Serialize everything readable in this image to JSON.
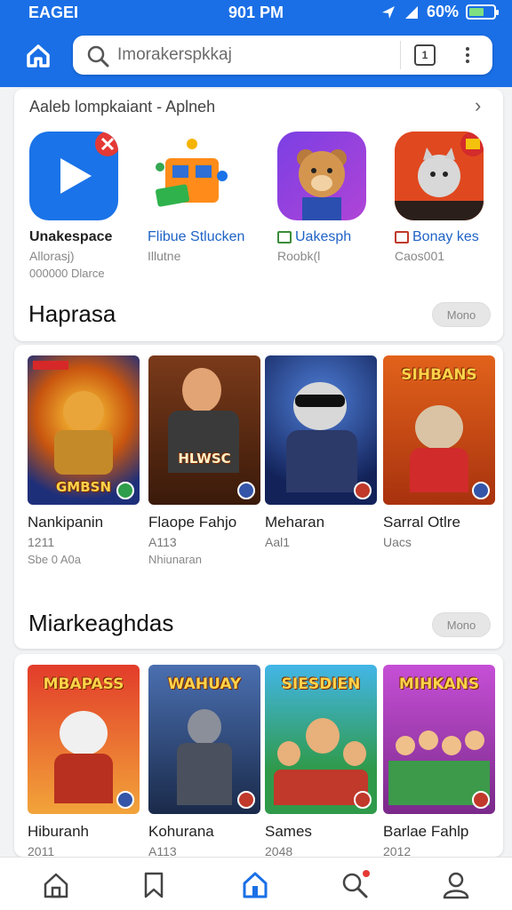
{
  "status_bar": {
    "carrier": "EAGEI",
    "time": "901 PM",
    "battery": "60%",
    "battery_level": 0.6
  },
  "app_bar": {
    "search_placeholder": "Imorakerspkkaj",
    "tabs_count": "1"
  },
  "featured": {
    "header": "Aaleb lompkaiant - Aplneh",
    "apps": [
      {
        "name": "Unakespace",
        "line1": "Allorasj)",
        "line2": "000000 Dlarce",
        "icon": "play-app-icon"
      },
      {
        "name": "Flibue Stlucken",
        "line1": "Illutne",
        "line2": "",
        "icon": "shop-app-icon"
      },
      {
        "name": "Uakesph",
        "line1": "Roobk(l",
        "line2": "",
        "icon": "bear-app-icon"
      },
      {
        "name": "Bonay kes",
        "line1": "Caos001",
        "line2": "",
        "icon": "cat-app-icon"
      }
    ]
  },
  "section1": {
    "title": "Haprasa",
    "more_label": "Mono",
    "games": [
      {
        "name": "Nankipanin",
        "line1": "1211",
        "line2": "Sbe 0 A0a",
        "poster_text": "GMBSN"
      },
      {
        "name": "Flaope Fahjo",
        "line1": "A113",
        "line2": "Nhiunaran",
        "poster_text": "HLWSC"
      },
      {
        "name": "Meharan",
        "line1": "Aal1",
        "line2": "",
        "poster_text": ""
      },
      {
        "name": "Sarral Otlre",
        "line1": "Uacs",
        "line2": "",
        "poster_text": "SIHBANS"
      }
    ]
  },
  "section2": {
    "title": "Miarkeaghdas",
    "more_label": "Mono",
    "games": [
      {
        "name": "Hiburanh",
        "line1": "2011",
        "poster_text": "MBAPASS"
      },
      {
        "name": "Kohurana",
        "line1": "A113",
        "poster_text": "WAHUAY"
      },
      {
        "name": "Sames",
        "line1": "2048",
        "poster_text": "SIESDIEN"
      },
      {
        "name": "Barlae Fahlp",
        "line1": "2012",
        "poster_text": "MIHKANS"
      }
    ]
  },
  "bottom_nav": {
    "items": [
      "home",
      "bookmarks",
      "store",
      "search",
      "profile"
    ],
    "active": "store"
  },
  "colors": {
    "primary": "#1a6fe6",
    "background": "#f1f3f5",
    "card": "#ffffff"
  }
}
